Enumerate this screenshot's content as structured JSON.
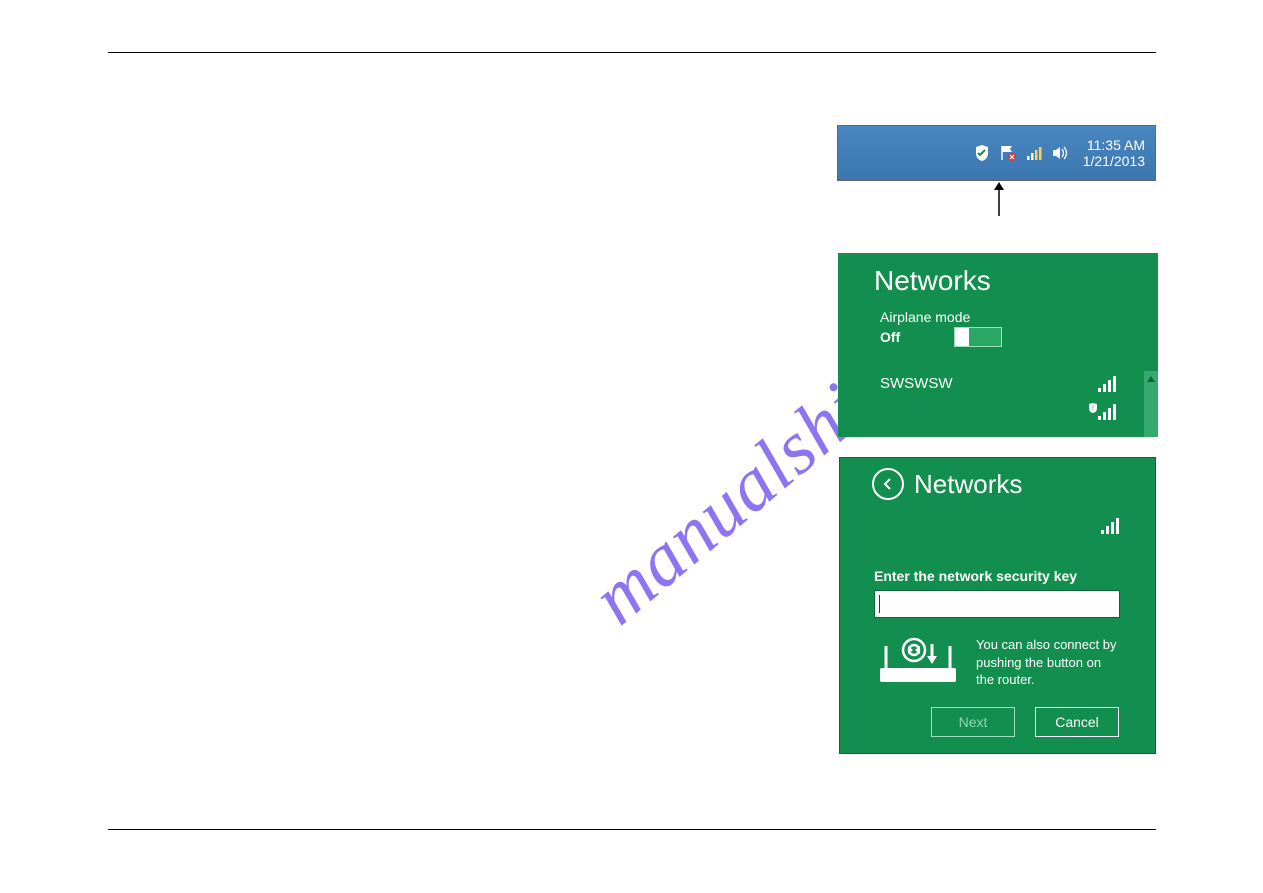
{
  "watermark": "manualshive.com",
  "tray": {
    "time": "11:35 AM",
    "date": "1/21/2013"
  },
  "panel1": {
    "title": "Networks",
    "airplane_label": "Airplane mode",
    "airplane_state": "Off",
    "network_name": "SWSWSW"
  },
  "panel2": {
    "title": "Networks",
    "label": "Enter the network security key",
    "wps_text": "You can also connect by pushing the button on the router.",
    "next_label": "Next",
    "cancel_label": "Cancel"
  }
}
